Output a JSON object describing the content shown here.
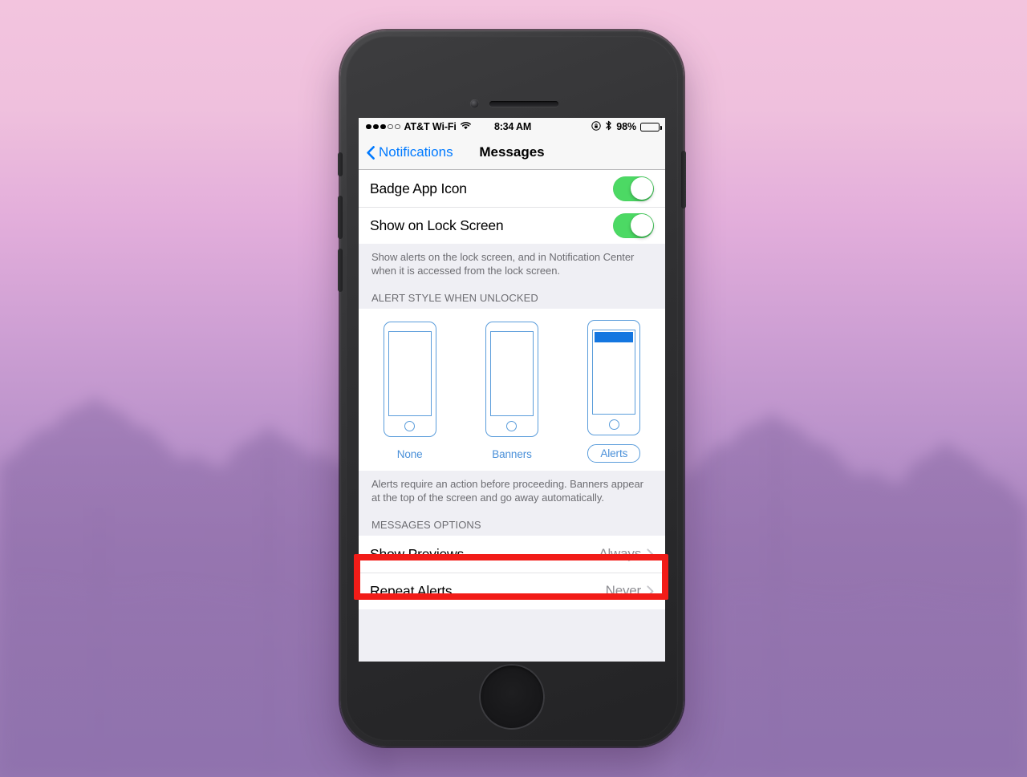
{
  "wallpaper": {
    "description": "blurred pink-to-purple forest treeline photograph",
    "top_color": "#f3c4de",
    "bottom_color": "#9477b0"
  },
  "device": {
    "name": "iPhone",
    "body_color": "#2e2e30"
  },
  "status_bar": {
    "signal_dots_filled": 3,
    "signal_dots_total": 5,
    "carrier": "AT&T Wi-Fi",
    "wifi_icon": "wifi-icon",
    "time": "8:34 AM",
    "rotation_lock_icon": "rotation-lock-icon",
    "bluetooth_icon": "bluetooth-icon",
    "battery_percent": "98%",
    "battery_level": 98
  },
  "nav_bar": {
    "back_label": "Notifications",
    "back_icon": "chevron-left-icon",
    "title": "Messages"
  },
  "settings": {
    "toggles": [
      {
        "label": "Badge App Icon",
        "state": "on"
      },
      {
        "label": "Show on Lock Screen",
        "state": "on"
      }
    ],
    "lock_screen_footer": "Show alerts on the lock screen, and in Notification Center when it is accessed from the lock screen.",
    "alert_style_header": "ALERT STYLE WHEN UNLOCKED",
    "alert_styles": [
      {
        "label": "None",
        "selected": false,
        "has_banner": false
      },
      {
        "label": "Banners",
        "selected": false,
        "has_banner": false
      },
      {
        "label": "Alerts",
        "selected": true,
        "has_banner": true
      }
    ],
    "alert_style_footer": "Alerts require an action before proceeding. Banners appear at the top of the screen and go away automatically.",
    "messages_options_header": "MESSAGES OPTIONS",
    "options": [
      {
        "label": "Show Previews",
        "value": "Always",
        "chevron": "chevron-right-icon",
        "highlighted": true
      },
      {
        "label": "Repeat Alerts",
        "value": "Never",
        "chevron": "chevron-right-icon",
        "highlighted": false
      }
    ]
  },
  "annotation": {
    "type": "highlight-rectangle",
    "color": "#f21c18",
    "target": "Show Previews"
  },
  "colors": {
    "ios_blue": "#007aff",
    "toggle_green": "#4cd964",
    "picker_blue": "#5b9ddb",
    "banner_blue": "#1476e0",
    "table_bg": "#efeff4",
    "secondary_text": "#8e8e93"
  }
}
